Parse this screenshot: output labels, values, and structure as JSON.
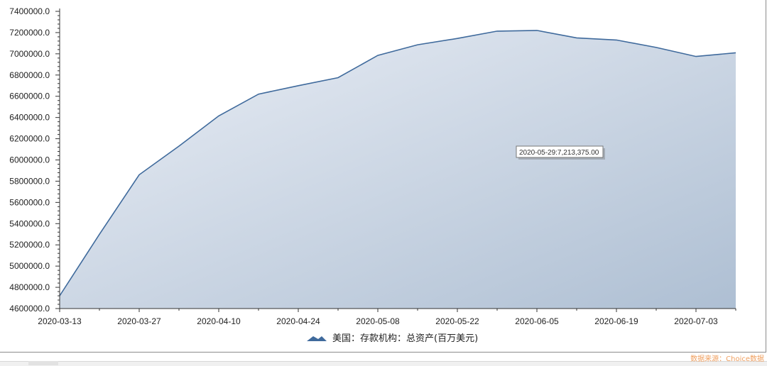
{
  "chart_data": {
    "type": "area",
    "x": [
      "2020-03-13",
      "2020-03-20",
      "2020-03-27",
      "2020-04-03",
      "2020-04-10",
      "2020-04-17",
      "2020-04-24",
      "2020-05-01",
      "2020-05-08",
      "2020-05-15",
      "2020-05-22",
      "2020-05-29",
      "2020-06-05",
      "2020-06-12",
      "2020-06-19",
      "2020-06-26",
      "2020-07-03",
      "2020-07-10"
    ],
    "series": [
      {
        "name": "美国：存款机构：总资产(百万美元)",
        "values": [
          4720000,
          5300000,
          5860000,
          6130000,
          6415000,
          6620000,
          6700000,
          6775000,
          6985000,
          7085000,
          7145000,
          7213375,
          7220000,
          7150000,
          7130000,
          7060000,
          6975000,
          7010000
        ],
        "color": "#3f6a9c"
      }
    ],
    "x_tick_labels": [
      "2020-03-13",
      "2020-03-27",
      "2020-04-10",
      "2020-04-24",
      "2020-05-08",
      "2020-05-22",
      "2020-06-05",
      "2020-06-19",
      "2020-07-03"
    ],
    "y_tick_labels": [
      "4600000.0",
      "4800000.0",
      "5000000.0",
      "5200000.0",
      "5400000.0",
      "5600000.0",
      "5800000.0",
      "6000000.0",
      "6200000.0",
      "6400000.0",
      "6600000.0",
      "6800000.0",
      "7000000.0",
      "7200000.0",
      "7400000.0"
    ],
    "ylim": [
      4600000,
      7400000
    ],
    "legend_position": "bottom-center",
    "grid": false,
    "fill_gradient": [
      "#ebeff6",
      "#aebfd3"
    ]
  },
  "tooltip": {
    "text": "2020-05-29:7,213,375.00"
  },
  "source_note": "数据来源：Choice数据"
}
